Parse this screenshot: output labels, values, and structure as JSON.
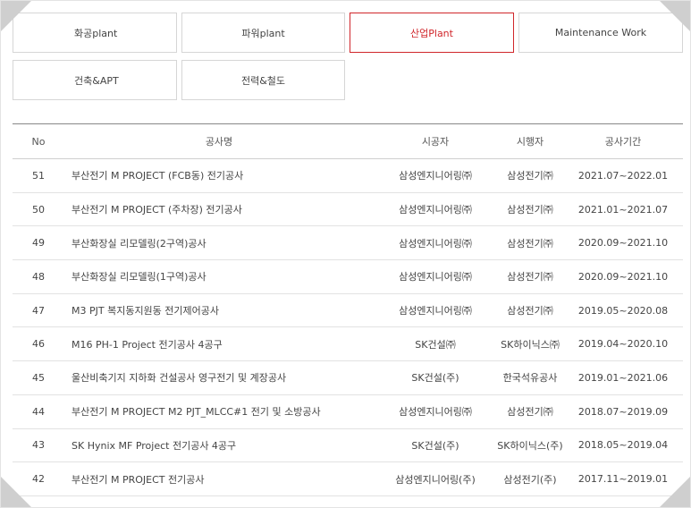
{
  "tabs": [
    {
      "label": "화공plant",
      "active": false
    },
    {
      "label": "파워plant",
      "active": false
    },
    {
      "label": "산업Plant",
      "active": true
    },
    {
      "label": "Maintenance Work",
      "active": false
    },
    {
      "label": "건축&APT",
      "active": false
    },
    {
      "label": "전력&철도",
      "active": false
    }
  ],
  "table": {
    "headers": {
      "no": "No",
      "name": "공사명",
      "contractor": "시공자",
      "executor": "시행자",
      "period": "공사기간"
    },
    "rows": [
      {
        "no": "51",
        "name": "부산전기 M PROJECT (FCB동) 전기공사",
        "contractor": "삼성엔지니어링㈜",
        "executor": "삼성전기㈜",
        "period": "2021.07~2022.01"
      },
      {
        "no": "50",
        "name": "부산전기 M PROJECT (주차장) 전기공사",
        "contractor": "삼성엔지니어링㈜",
        "executor": "삼성전기㈜",
        "period": "2021.01~2021.07"
      },
      {
        "no": "49",
        "name": "부산화장실 리모델링(2구역)공사",
        "contractor": "삼성엔지니어링㈜",
        "executor": "삼성전기㈜",
        "period": "2020.09~2021.10"
      },
      {
        "no": "48",
        "name": "부산화장실 리모델링(1구역)공사",
        "contractor": "삼성엔지니어링㈜",
        "executor": "삼성전기㈜",
        "period": "2020.09~2021.10"
      },
      {
        "no": "47",
        "name": "M3 PJT 복지동지원동 전기제어공사",
        "contractor": "삼성엔지니어링㈜",
        "executor": "삼성전기㈜",
        "period": "2019.05~2020.08"
      },
      {
        "no": "46",
        "name": "M16 PH-1 Project 전기공사 4공구",
        "contractor": "SK건설㈜",
        "executor": "SK하이닉스㈜",
        "period": "2019.04~2020.10"
      },
      {
        "no": "45",
        "name": "울산비축기지 지하화 건설공사 영구전기 및 계장공사",
        "contractor": "SK건설(주)",
        "executor": "한국석유공사",
        "period": "2019.01~2021.06"
      },
      {
        "no": "44",
        "name": "부산전기 M PROJECT M2 PJT_MLCC#1 전기 및 소방공사",
        "contractor": "삼성엔지니어링㈜",
        "executor": "삼성전기㈜",
        "period": "2018.07~2019.09"
      },
      {
        "no": "43",
        "name": "SK Hynix MF Project 전기공사 4공구",
        "contractor": "SK건설(주)",
        "executor": "SK하이닉스(주)",
        "period": "2018.05~2019.04"
      },
      {
        "no": "42",
        "name": "부산전기 M PROJECT 전기공사",
        "contractor": "삼성엔지니어링(주)",
        "executor": "삼성전기(주)",
        "period": "2017.11~2019.01"
      }
    ]
  }
}
